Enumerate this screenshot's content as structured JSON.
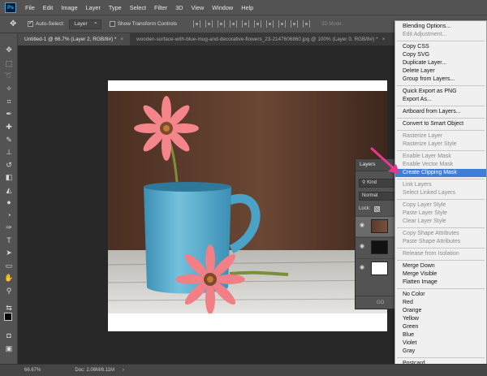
{
  "app": {
    "logo": "Ps"
  },
  "menubar": {
    "items": [
      "File",
      "Edit",
      "Image",
      "Layer",
      "Type",
      "Select",
      "Filter",
      "3D",
      "View",
      "Window",
      "Help"
    ]
  },
  "options": {
    "auto_select_label": "Auto-Select:",
    "auto_select_checked": true,
    "auto_select_value": "Layer",
    "transform_label": "Show Transform Controls",
    "transform_checked": false,
    "mode3d_label": "3D Mode:"
  },
  "tabs": [
    {
      "label": "Untitled-1 @ 66.7% (Layer 2, RGB/8#) *",
      "active": true
    },
    {
      "label": "wooden-surface-with-blue-mug-and-decorative-flowers_23-2147606860.jpg @ 100% (Layer 0, RGB/8#) *",
      "active": false
    }
  ],
  "status": {
    "zoom": "66.67%",
    "doc": "Doc: 2.06M/6.11M",
    "arrow": "›"
  },
  "layers_panel": {
    "tab_label": "Layers",
    "kind_label": "Kind",
    "blend_mode": "Normal",
    "lock_label": "Lock:",
    "bottom_label": "GO"
  },
  "context_menu": {
    "items": [
      {
        "label": "Blending Options...",
        "disabled": false
      },
      {
        "label": "Edit Adjustment...",
        "disabled": true
      },
      {
        "sep": true
      },
      {
        "label": "Copy CSS",
        "disabled": false
      },
      {
        "label": "Copy SVG",
        "disabled": false
      },
      {
        "label": "Duplicate Layer...",
        "disabled": false
      },
      {
        "label": "Delete Layer",
        "disabled": false
      },
      {
        "label": "Group from Layers...",
        "disabled": false
      },
      {
        "sep": true
      },
      {
        "label": "Quick Export as PNG",
        "disabled": false
      },
      {
        "label": "Export As...",
        "disabled": false
      },
      {
        "sep": true
      },
      {
        "label": "Artboard from Layers...",
        "disabled": false
      },
      {
        "sep": true
      },
      {
        "label": "Convert to Smart Object",
        "disabled": false
      },
      {
        "sep": true
      },
      {
        "label": "Rasterize Layer",
        "disabled": true
      },
      {
        "label": "Rasterize Layer Style",
        "disabled": true
      },
      {
        "sep": true
      },
      {
        "label": "Enable Layer Mask",
        "disabled": true
      },
      {
        "label": "Enable Vector Mask",
        "disabled": true
      },
      {
        "label": "Create Clipping Mask",
        "disabled": false,
        "highlighted": true
      },
      {
        "sep": true
      },
      {
        "label": "Link Layers",
        "disabled": true
      },
      {
        "label": "Select Linked Layers",
        "disabled": true
      },
      {
        "sep": true
      },
      {
        "label": "Copy Layer Style",
        "disabled": true
      },
      {
        "label": "Paste Layer Style",
        "disabled": true
      },
      {
        "label": "Clear Layer Style",
        "disabled": true
      },
      {
        "sep": true
      },
      {
        "label": "Copy Shape Attributes",
        "disabled": true
      },
      {
        "label": "Paste Shape Attributes",
        "disabled": true
      },
      {
        "sep": true
      },
      {
        "label": "Release from Isolation",
        "disabled": true
      },
      {
        "sep": true
      },
      {
        "label": "Merge Down",
        "disabled": false
      },
      {
        "label": "Merge Visible",
        "disabled": false
      },
      {
        "label": "Flatten Image",
        "disabled": false
      },
      {
        "sep": true
      },
      {
        "label": "No Color",
        "disabled": false
      },
      {
        "label": "Red",
        "disabled": false
      },
      {
        "label": "Orange",
        "disabled": false
      },
      {
        "label": "Yellow",
        "disabled": false
      },
      {
        "label": "Green",
        "disabled": false
      },
      {
        "label": "Blue",
        "disabled": false
      },
      {
        "label": "Violet",
        "disabled": false
      },
      {
        "label": "Gray",
        "disabled": false
      },
      {
        "sep": true
      },
      {
        "label": "Postcard",
        "disabled": false
      }
    ]
  },
  "colors": {
    "highlight": "#3d7fd6",
    "pointer": "#e8388a",
    "ui_panel": "#535353",
    "workspace": "#282828"
  }
}
